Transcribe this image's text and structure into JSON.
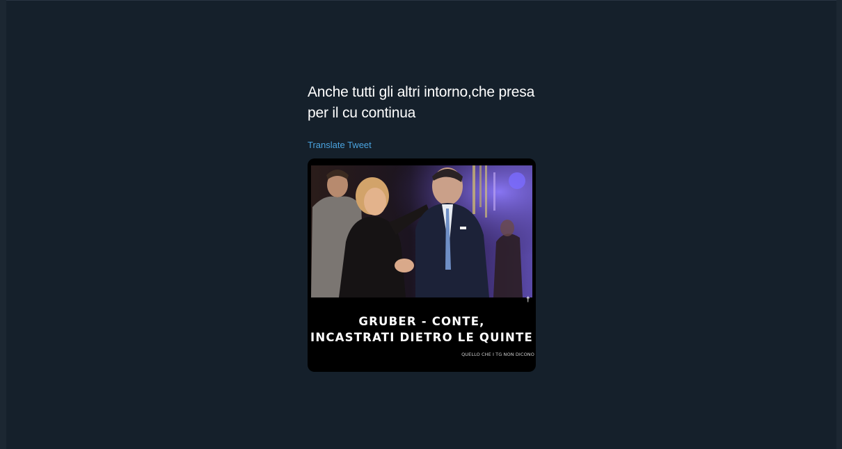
{
  "tweet": {
    "text_line1": "Anche tutti gli altri intorno,che presa",
    "text_line2": "per il cu continua",
    "translate_label": "Translate Tweet"
  },
  "media": {
    "headline_line1": "GRUBER - CONTE,",
    "headline_line2": "INCASTRATI DIETRO LE QUINTE",
    "source_caption": "QUELLO CHE I TG NON DICONO",
    "marker_glyph": "†"
  },
  "colors": {
    "background": "#15202b",
    "text": "#ffffff",
    "link": "#4aa3df",
    "media_background": "#000000"
  }
}
